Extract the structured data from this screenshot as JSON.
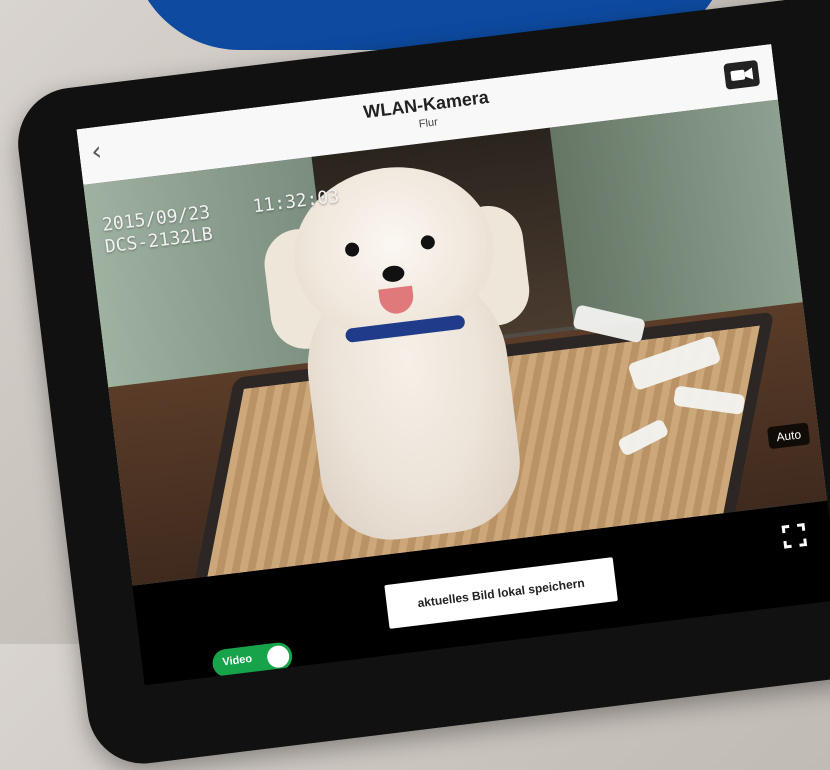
{
  "header": {
    "title": "WLAN-Kamera",
    "subtitle": "Flur"
  },
  "overlay": {
    "date": "2015/09/23",
    "time": "11:32:03",
    "camera_model": "DCS-2132LB",
    "auto_label": "Auto"
  },
  "controls": {
    "save_label": "aktuelles Bild lokal speichern",
    "video_toggle_label": "Video",
    "video_toggle_on": true
  },
  "icons": {
    "back": "chevron-left-icon",
    "camera": "video-camera-icon",
    "fullscreen": "fullscreen-icon"
  },
  "colors": {
    "accent": "#16a34a",
    "banner": "#0d4aa0",
    "bezel": "#111111"
  }
}
